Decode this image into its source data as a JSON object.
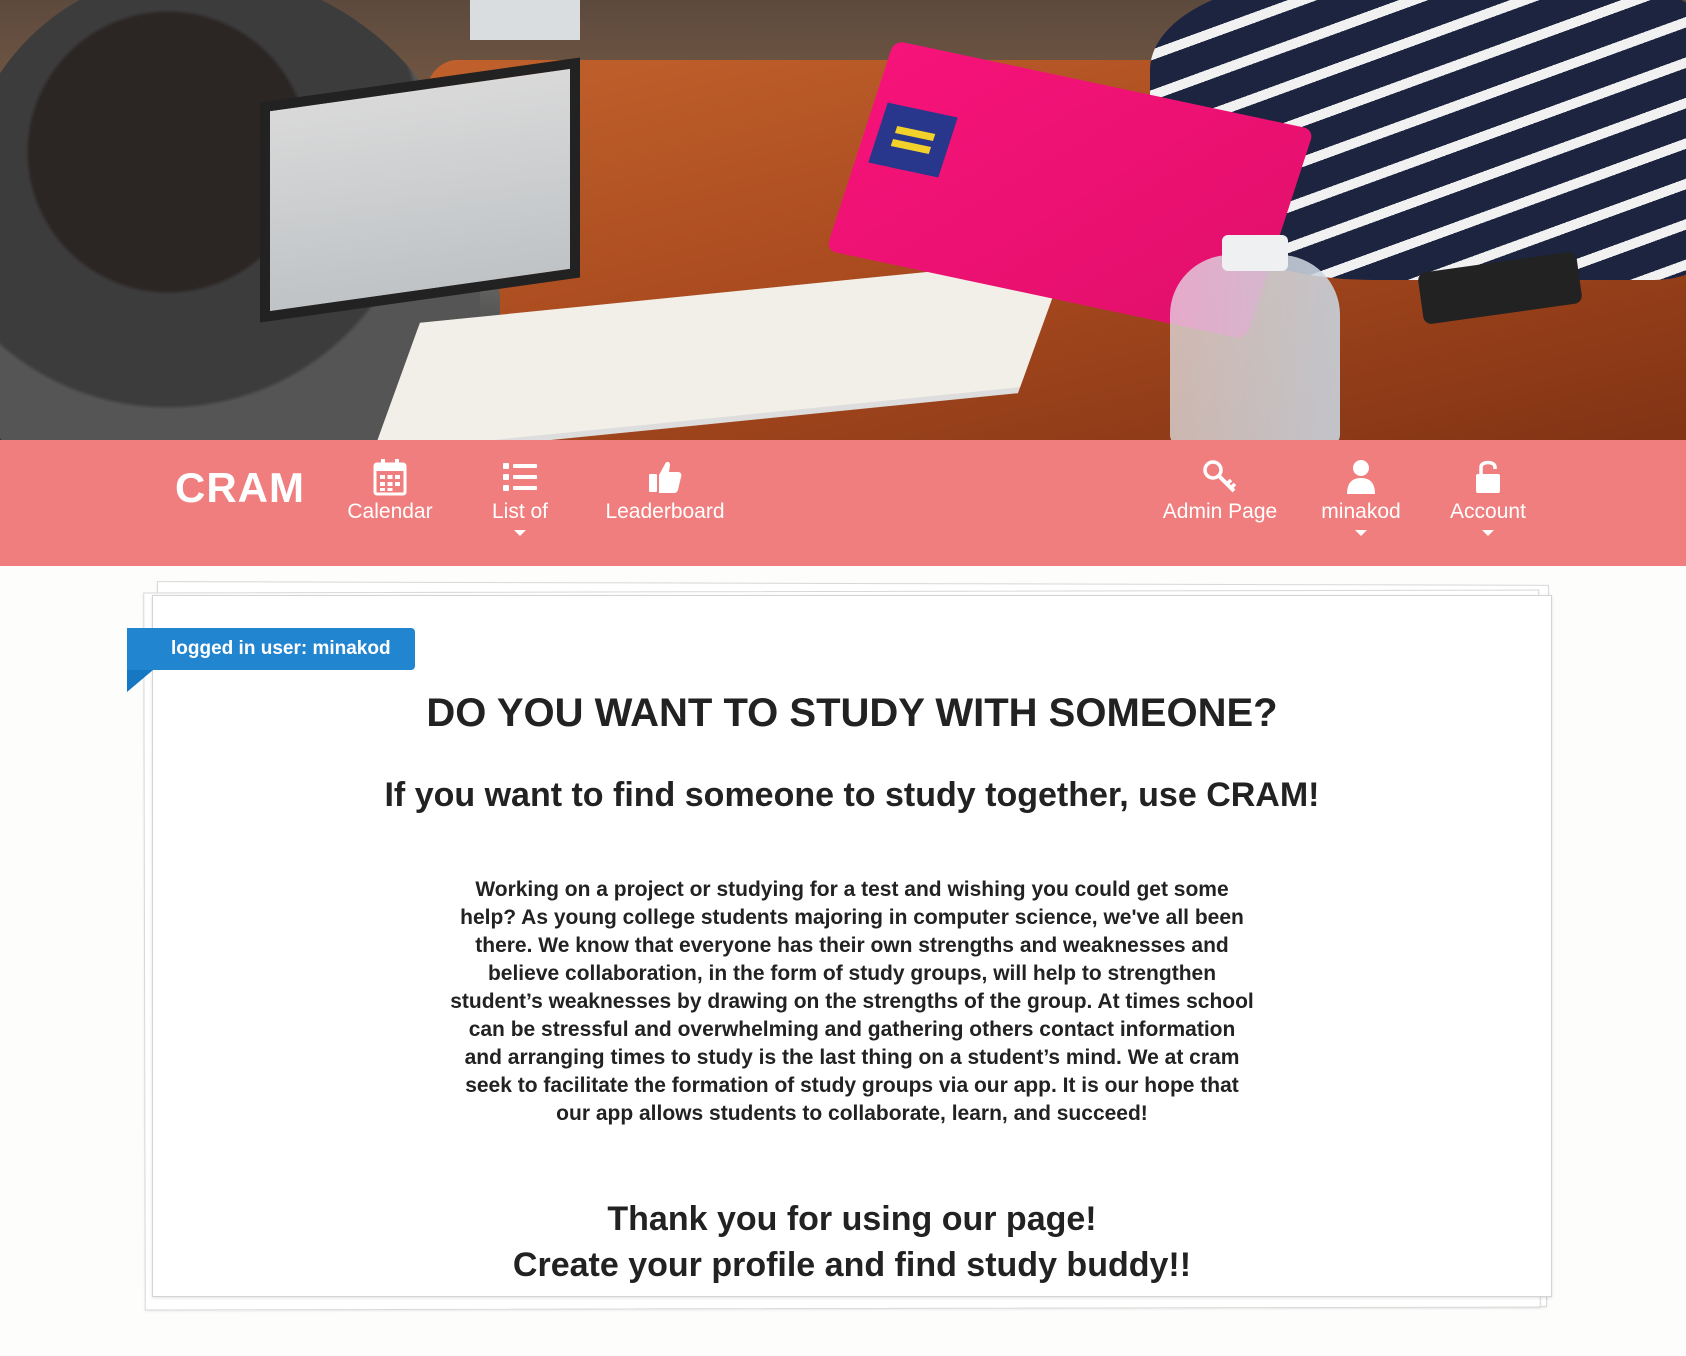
{
  "brand": {
    "name": "CRAM"
  },
  "nav": {
    "left": [
      {
        "label": "Calendar",
        "icon": "calendar-icon",
        "dropdown": false
      },
      {
        "label": "List of",
        "icon": "list-icon",
        "dropdown": true
      },
      {
        "label": "Leaderboard",
        "icon": "thumbs-up-icon",
        "dropdown": false
      }
    ],
    "right": [
      {
        "label": "Admin Page",
        "icon": "key-icon",
        "dropdown": false
      },
      {
        "label": "minakod",
        "icon": "user-icon",
        "dropdown": true
      },
      {
        "label": "Account",
        "icon": "unlock-icon",
        "dropdown": true
      }
    ]
  },
  "card": {
    "ribbon": "logged in user: minakod",
    "heading": "DO YOU WANT TO STUDY WITH SOMEONE?",
    "subheading": "If you want to find someone to study together, use CRAM!",
    "paragraph": "Working on a project or studying for a test and wishing you could get some help? As young college students majoring in computer science, we've all been there. We know that everyone has their own strengths and weaknesses and believe collaboration, in the form of study groups, will help to strengthen student’s weaknesses by drawing on the strengths of the group. At times school can be stressful and overwhelming and gathering others contact information and arranging times to study is the last thing on a student’s mind. We at cram seek to facilitate the formation of study groups via our app. It is our hope that our app allows students to collaborate, learn, and succeed!",
    "thanks_line1": "Thank you for using our page!",
    "thanks_line2": "Create your profile and find study buddy!!"
  },
  "colors": {
    "navbar": "#f07e7e",
    "ribbon": "#2185d0",
    "text": "#222222"
  }
}
